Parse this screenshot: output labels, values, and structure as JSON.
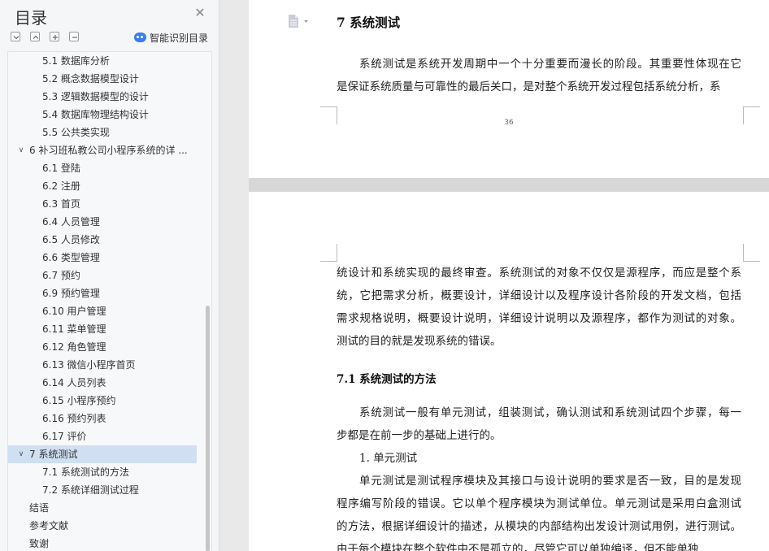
{
  "sidebar": {
    "title": "目录",
    "smart_label": "智能识别目录",
    "toc": [
      {
        "label": "5.1 数据库分析",
        "level": 2
      },
      {
        "label": "5.2 概念数据模型设计",
        "level": 2
      },
      {
        "label": "5.3 逻辑数据模型的设计",
        "level": 2
      },
      {
        "label": "5.4 数据库物理结构设计",
        "level": 2
      },
      {
        "label": "5.5 公共类实现",
        "level": 2
      },
      {
        "label": "6 补习班私教公司小程序系统的详 ...",
        "level": 1,
        "expanded": true
      },
      {
        "label": "6.1  登陆",
        "level": 2
      },
      {
        "label": "6.2  注册",
        "level": 2
      },
      {
        "label": "6.3  首页",
        "level": 2
      },
      {
        "label": "6.4  人员管理",
        "level": 2
      },
      {
        "label": "6.5 人员修改",
        "level": 2
      },
      {
        "label": "6.6 类型管理",
        "level": 2
      },
      {
        "label": "6.7 预约",
        "level": 2
      },
      {
        "label": "6.9 预约管理",
        "level": 2
      },
      {
        "label": "6.10  用户管理",
        "level": 2
      },
      {
        "label": "6.11 菜单管理",
        "level": 2
      },
      {
        "label": "6.12 角色管理",
        "level": 2
      },
      {
        "label": "6.13 微信小程序首页",
        "level": 2
      },
      {
        "label": "6.14 人员列表",
        "level": 2
      },
      {
        "label": "6.15 小程序预约",
        "level": 2
      },
      {
        "label": "6.16 预约列表",
        "level": 2
      },
      {
        "label": "6.17 评价",
        "level": 2
      },
      {
        "label": "7 系统测试",
        "level": 1,
        "expanded": true,
        "selected": true
      },
      {
        "label": "7.1 系统测试的方法",
        "level": 2
      },
      {
        "label": "7.2 系统详细测试过程",
        "level": 2
      },
      {
        "label": "结语",
        "level": 0
      },
      {
        "label": "参考文献",
        "level": 0
      },
      {
        "label": "致谢",
        "level": 0
      }
    ]
  },
  "document": {
    "page1": {
      "heading": "7 系统测试",
      "para_lines": [
        "系统测试是系统开发周期中一个十分重要而漫长的阶段。其重要性体现在它",
        "是保证系统质量与可靠性的最后关口，是对整个系统开发过程包括系统分析，系"
      ],
      "page_number": "36"
    },
    "page2": {
      "para1_lines": [
        "统设计和系统实现的最终审查。系统测试的对象不仅仅是源程序，而应是整个系",
        "统，它把需求分析，概要设计，详细设计以及程序设计各阶段的开发文档，包括",
        "需求规格说明，概要设计说明，详细设计说明以及源程序，都作为测试的对象。",
        "测试的目的就是发现系统的错误。"
      ],
      "subheading": "7.1 系统测试的方法",
      "para2_lines": [
        "系统测试一般有单元测试，组装测试，确认测试和系统测试四个步骤，每一",
        "步都是在前一步的基础上进行的。"
      ],
      "list_item": "1.  单元测试",
      "para3_lines": [
        "单元测试是测试程序模块及其接口与设计说明的要求是否一致，目的是发现",
        "程序编写阶段的错误。它以单个程序模块为测试单位。单元测试是采用白盒测试",
        "的方法，根据详细设计的描述，从模块的内部结构出发设计测试用例，进行测试。",
        "由于每个模块在整个软件中不是孤立的，尽管它可以单独编译，但不能单独"
      ]
    }
  }
}
